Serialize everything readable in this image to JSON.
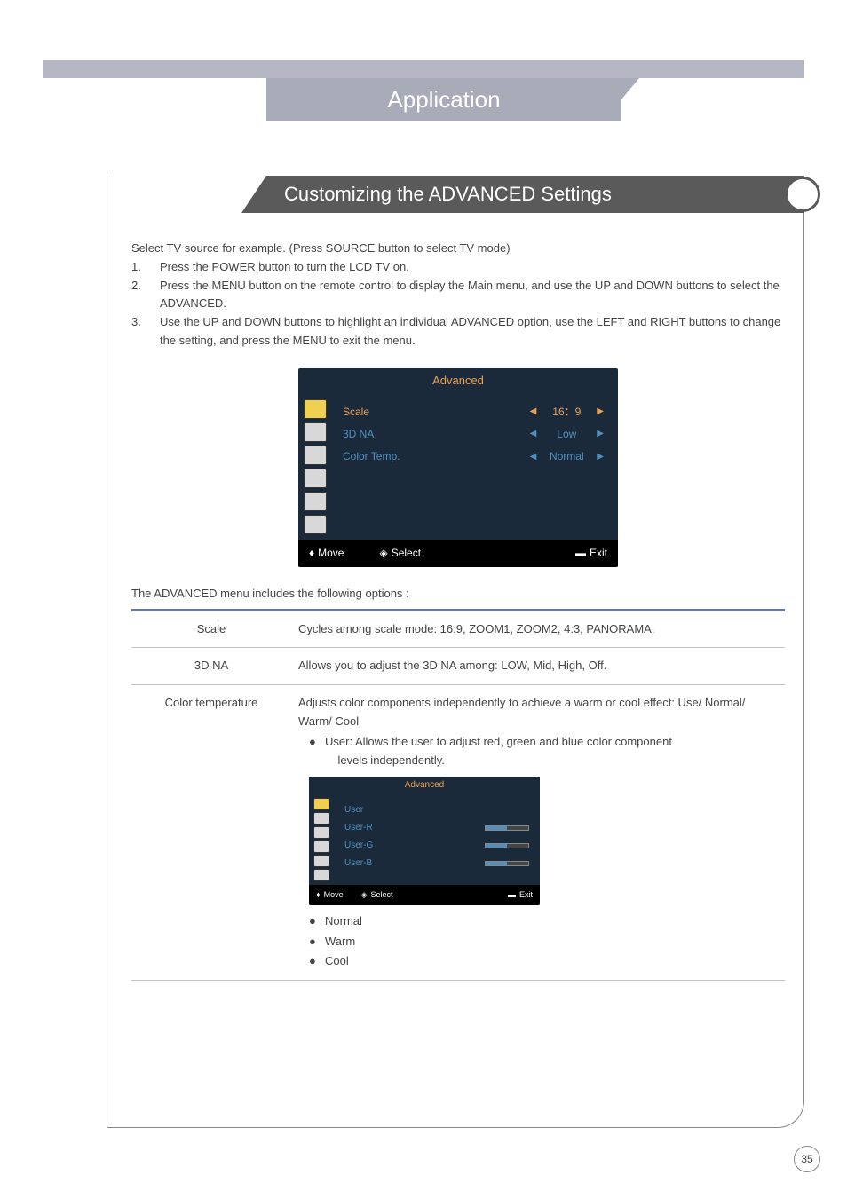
{
  "header": {
    "title": "Application"
  },
  "section": {
    "title": "Customizing the ADVANCED Settings"
  },
  "intro": {
    "lead": "Select TV source for example. (Press SOURCE button to select TV mode)",
    "steps": [
      "Press the POWER button to turn the LCD TV on.",
      "Press the MENU button on the remote control to display the Main menu, and use the UP and DOWN buttons to select the ADVANCED.",
      "Use the UP and DOWN buttons to highlight an individual ADVANCED option, use the LEFT and RIGHT buttons to change the setting, and press the MENU to exit the menu."
    ]
  },
  "osd1": {
    "title": "Advanced",
    "rows": [
      {
        "label": "Scale",
        "value": "16：9",
        "sel": true
      },
      {
        "label": "3D NA",
        "value": "Low",
        "sel": false
      },
      {
        "label": "Color Temp.",
        "value": "Normal",
        "sel": false
      }
    ],
    "footer": {
      "move": "Move",
      "select": "Select",
      "exit": "Exit"
    }
  },
  "options_intro": "The ADVANCED menu includes the following options :",
  "table": {
    "rows": [
      {
        "name": "Scale",
        "desc": "Cycles among scale mode: 16:9, ZOOM1, ZOOM2, 4:3, PANORAMA."
      },
      {
        "name": "3D NA",
        "desc": "Allows you to adjust the 3D NA among: LOW, Mid, High, Off."
      },
      {
        "name": "Color temperature",
        "desc": "Adjusts color components independently to achieve a warm or cool effect: Use/ Normal/ Warm/ Cool",
        "bullet1_label": "User: Allows the user to adjust red, green and blue color component",
        "bullet1_sub": "levels independently.",
        "list_after": [
          "Normal",
          "Warm",
          "Cool"
        ]
      }
    ]
  },
  "osd2": {
    "title": "Advanced",
    "rows": [
      {
        "label": "User"
      },
      {
        "label": "User-R"
      },
      {
        "label": "User-G"
      },
      {
        "label": "User-B"
      }
    ],
    "footer": {
      "move": "Move",
      "select": "Select",
      "exit": "Exit"
    }
  },
  "page_number": "35"
}
